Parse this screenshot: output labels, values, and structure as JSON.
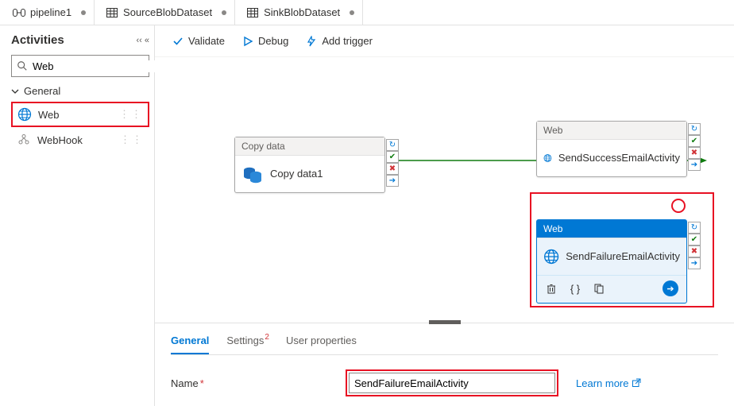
{
  "tabs": [
    {
      "icon": "pipeline",
      "label": "pipeline1",
      "dirty": true
    },
    {
      "icon": "dataset",
      "label": "SourceBlobDataset",
      "dirty": true
    },
    {
      "icon": "dataset",
      "label": "SinkBlobDataset",
      "dirty": true
    }
  ],
  "sidebar": {
    "title": "Activities",
    "search_value": "Web",
    "group": "General",
    "items": [
      {
        "label": "Web",
        "icon": "web",
        "highlight": true
      },
      {
        "label": "WebHook",
        "icon": "webhook",
        "highlight": false
      }
    ]
  },
  "toolbar": {
    "validate": "Validate",
    "debug": "Debug",
    "add_trigger": "Add trigger"
  },
  "canvas": {
    "copy": {
      "header": "Copy data",
      "title": "Copy data1"
    },
    "success": {
      "header": "Web",
      "title": "SendSuccessEmailActivity"
    },
    "failure": {
      "header": "Web",
      "title": "SendFailureEmailActivity"
    }
  },
  "panel": {
    "tabs": {
      "general": "General",
      "settings": "Settings",
      "settings_badge": "2",
      "user_props": "User properties"
    },
    "name_label": "Name",
    "name_value": "SendFailureEmailActivity",
    "learn_more": "Learn more"
  }
}
